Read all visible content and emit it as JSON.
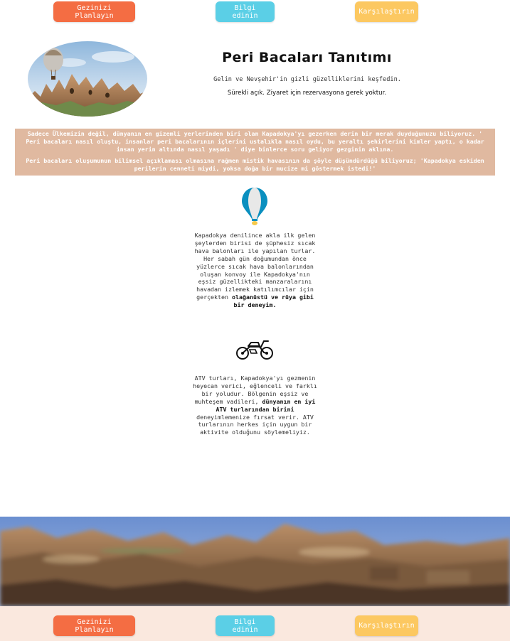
{
  "nav": {
    "plan_label": "Gezinizi Planlayın",
    "info_label": "Bilgi edinin",
    "compare_label": "Karşılaştırın"
  },
  "header": {
    "title": "Peri Bacaları Tanıtımı",
    "subtitle": "Gelin ve Nevşehir'in gizli güzelliklerini keşfedin.",
    "hours": "Sürekli açık. Ziyaret için rezervasyona gerek yoktur."
  },
  "intro": {
    "paragraph1": "Sadece Ülkemizin değil, dünyanın en gizemli yerlerinden biri olan Kapadokya'yı gezerken derin bir merak duyduğunuzu biliyoruz. ' Peri bacaları nasıl oluştu, insanlar peri bacalarının içlerini ustalıkla nasıl oydu, bu yeraltı şehirlerini kimler yaptı, o kadar insan yerin altında nasıl yaşadı ' diye binlerce soru geliyor gezginin aklına.",
    "paragraph2": "Peri bacaları oluşumunun bilimsel açıklaması olmasına rağmen mistik havasının da şöyle düşündürdüğü biliyoruz; 'Kapadokya eskiden perilerin cenneti miydi, yoksa doğa bir mucize mi göstermek istedi!'"
  },
  "features": [
    {
      "icon": "hot-air-balloon-icon",
      "text": "Kapadokya denilince akla ilk gelen şeylerden birisi de şüphesiz sıcak hava balonları ile yapılan turlar. Her sabah gün doğumundan önce yüzlerce sıcak hava balonlarından oluşan konvoy ile Kapadokya'nın eşsiz güzellikteki manzaralarını havadan izlemek katılımcılar için gerçekten ",
      "bold": "olağanüstü ve rüya gibi bir deneyim.",
      "after": ""
    },
    {
      "icon": "motorcycle-icon",
      "text": "ATV turları, Kapadokya'yı gezmenin heyecan verici, eğlenceli ve farklı bir yoludur. Bölgenin eşsiz ve muhteşem vadileri, ",
      "bold": "dünyanın en iyi ATV turlarından birini",
      "after": " deneyimlemenize fırsat verir. ATV turlarının herkes için uygun bir aktivite olduğunu söylemeliyiz."
    }
  ],
  "colors": {
    "orange": "#f46d43",
    "blue": "#5bcfe6",
    "yellow": "#fcc861",
    "intro_bg": "#e0b9a0",
    "footer_bg": "#fae8de"
  }
}
